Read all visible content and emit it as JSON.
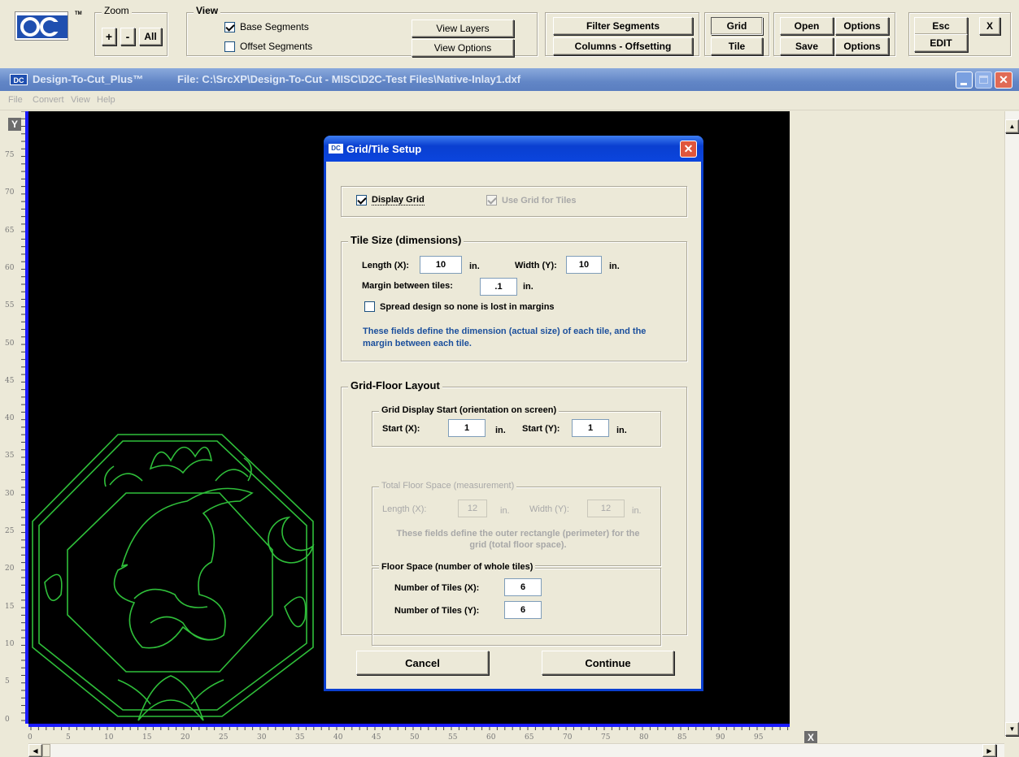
{
  "toolbar": {
    "zoom": {
      "label": "Zoom",
      "plus": "+",
      "minus": "-",
      "all": "All"
    },
    "view": {
      "label": "View",
      "base_segments": "Base Segments",
      "offset_segments": "Offset Segments",
      "view_layers": "View Layers",
      "view_options": "View Options"
    },
    "filter_segments": "Filter Segments",
    "columns_offsetting": "Columns - Offsetting",
    "grid": "Grid",
    "tile": "Tile",
    "open": "Open",
    "save": "Save",
    "options1": "Options",
    "options2": "Options",
    "esc": "Esc",
    "edit": "EDIT",
    "x": "X",
    "logo_tm": "TM"
  },
  "window": {
    "icon_text": "DC",
    "title_app": "Design-To-Cut_Plus™",
    "title_file": "File:  C:\\SrcXP\\Design-To-Cut - MISC\\D2C-Test Files\\Native-Inlay1.dxf"
  },
  "menu": [
    "File",
    "Convert",
    "View",
    "Help"
  ],
  "axes": {
    "y_label": "Y",
    "x_label": "X",
    "y_ticks": [
      "75",
      "70",
      "65",
      "60",
      "55",
      "50",
      "45",
      "40",
      "35",
      "30",
      "25",
      "20",
      "15",
      "10",
      "5",
      "0"
    ],
    "x_ticks": [
      "0",
      "5",
      "10",
      "15",
      "20",
      "25",
      "30",
      "35",
      "40",
      "45",
      "50",
      "55",
      "60",
      "65",
      "70",
      "75",
      "80",
      "85",
      "90",
      "95"
    ]
  },
  "dialog": {
    "icon_text": "DC",
    "title": "Grid/Tile Setup",
    "display_grid": "Display Grid",
    "use_grid_for_tiles": "Use Grid for Tiles",
    "tile_size": {
      "legend": "Tile Size (dimensions)",
      "length_label": "Length (X):",
      "length_value": "10",
      "width_label": "Width (Y):",
      "width_value": "10",
      "unit": "in.",
      "margin_label": "Margin between tiles:",
      "margin_value": ".1",
      "spread": "Spread design so none is lost in margins",
      "note": "These fields define the dimension (actual size) of each tile, and the margin between each tile."
    },
    "grid_floor": {
      "legend": "Grid-Floor Layout",
      "display_start": {
        "legend": "Grid Display Start (orientation on screen)",
        "start_x_label": "Start  (X):",
        "start_x_value": "1",
        "start_y_label": "Start (Y):",
        "start_y_value": "1",
        "unit": "in."
      },
      "total_floor": {
        "legend": "Total Floor Space (measurement)",
        "length_label": "Length (X):",
        "length_value": "12",
        "width_label": "Width (Y):",
        "width_value": "12",
        "unit": "in.",
        "note": "These fields define the outer rectangle (perimeter) for the grid (total floor space)."
      },
      "floor_space": {
        "legend": "Floor Space (number of whole tiles)",
        "tiles_x_label": "Number of Tiles (X):",
        "tiles_x_value": "6",
        "tiles_y_label": "Number of Tiles (Y):",
        "tiles_y_value": "6"
      }
    },
    "cancel": "Cancel",
    "continue": "Continue"
  },
  "colors": {
    "canvas": "#000000",
    "design": "#2fbf3a",
    "title_bar": "#6b8fc9",
    "dialog_title": "#2559d8",
    "note_text": "#1b4f9c",
    "axis_line": "#1a1aff"
  }
}
